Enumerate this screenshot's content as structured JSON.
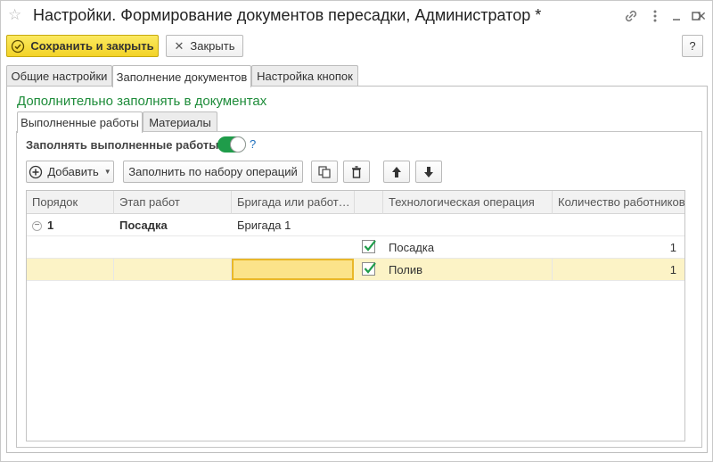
{
  "window": {
    "title": "Настройки. Формирование документов пересадки, Администратор *",
    "controls": [
      "link-icon",
      "more-icon",
      "minimize-icon",
      "maximize-icon",
      "close-icon"
    ]
  },
  "toolbar": {
    "save_close_label": "Сохранить и закрыть",
    "close_label": "Закрыть",
    "help_label": "?"
  },
  "tabs": [
    {
      "label": "Общие настройки",
      "active": false
    },
    {
      "label": "Заполнение документов",
      "active": true
    },
    {
      "label": "Настройка кнопок",
      "active": false
    }
  ],
  "section": {
    "title": "Дополнительно заполнять в документах"
  },
  "subtabs": [
    {
      "label": "Выполненные работы",
      "active": true
    },
    {
      "label": "Материалы",
      "active": false
    }
  ],
  "fill_option": {
    "label": "Заполнять выполненные работы:",
    "enabled": true,
    "help": "?"
  },
  "grid_toolbar": {
    "add_label": "Добавить",
    "fill_by_ops_label": "Заполнить по набору операций"
  },
  "grid": {
    "columns": [
      "Порядок",
      "Этап работ",
      "Бригада или работ…",
      "",
      "Технологическая операция",
      "Количество работников"
    ],
    "rows": [
      {
        "order": "1",
        "stage": "Посадка",
        "brigade": "Бригада 1",
        "checked": null,
        "operation": "",
        "workers": "",
        "group": true
      },
      {
        "order": "",
        "stage": "",
        "brigade": "",
        "checked": true,
        "operation": "Посадка",
        "workers": "1",
        "group": false
      },
      {
        "order": "",
        "stage": "",
        "brigade": "",
        "checked": true,
        "operation": "Полив",
        "workers": "1",
        "group": false,
        "selected": true
      }
    ]
  },
  "colors": {
    "accent_yellow": "#f3d327",
    "section_green": "#1e8c3a",
    "toggle_green": "#1f9c4a",
    "selected_row": "#fcf3c6",
    "focus_cell": "#fbe38a"
  }
}
